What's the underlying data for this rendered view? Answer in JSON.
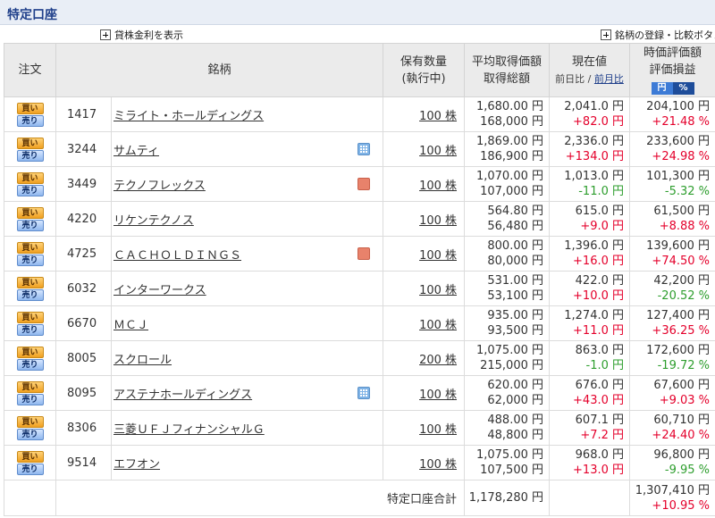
{
  "page_title": "特定口座",
  "toolbar": {
    "lending_label": "貸株金利を表示",
    "register_label": "銘柄の登録・比較ボタン"
  },
  "headers": {
    "order": "注文",
    "name": "銘柄",
    "qty_line1": "保有数量",
    "qty_line2": "(執行中)",
    "avg_line1": "平均取得価額",
    "avg_line2": "取得総額",
    "cur_line1": "現在値",
    "cur_sub_prev_day": "前日比",
    "cur_sub_sep": "/",
    "cur_sub_prev_month": "前月比",
    "val_line1": "時価評価額",
    "val_line2": "評価損益",
    "toggle_yen": "円",
    "toggle_pct": "%"
  },
  "buttons": {
    "buy": "買い",
    "sell": "売り"
  },
  "rows": [
    {
      "code": "1417",
      "name": "ミライト・ホールディングス",
      "badge": "",
      "qty": "100 株",
      "avg_price": "1,680.00 円",
      "avg_total": "168,000 円",
      "current": "2,041.0 円",
      "change": "+82.0 円",
      "change_class": "pos",
      "value": "204,100 円",
      "pl": "+21.48 %",
      "pl_class": "pos"
    },
    {
      "code": "3244",
      "name": "サムティ",
      "badge": "calc",
      "qty": "100 株",
      "avg_price": "1,869.00 円",
      "avg_total": "186,900 円",
      "current": "2,336.0 円",
      "change": "+134.0 円",
      "change_class": "pos",
      "value": "233,600 円",
      "pl": "+24.98 %",
      "pl_class": "pos"
    },
    {
      "code": "3449",
      "name": "テクノフレックス",
      "badge": "info",
      "qty": "100 株",
      "avg_price": "1,070.00 円",
      "avg_total": "107,000 円",
      "current": "1,013.0 円",
      "change": "-11.0 円",
      "change_class": "neg",
      "value": "101,300 円",
      "pl": "-5.32 %",
      "pl_class": "neg"
    },
    {
      "code": "4220",
      "name": "リケンテクノス",
      "badge": "",
      "qty": "100 株",
      "avg_price": "564.80 円",
      "avg_total": "56,480 円",
      "current": "615.0 円",
      "change": "+9.0 円",
      "change_class": "pos",
      "value": "61,500 円",
      "pl": "+8.88 %",
      "pl_class": "pos"
    },
    {
      "code": "4725",
      "name": "ＣＡＣＨＯＬＤＩＮＧＳ",
      "badge": "info",
      "qty": "100 株",
      "avg_price": "800.00 円",
      "avg_total": "80,000 円",
      "current": "1,396.0 円",
      "change": "+16.0 円",
      "change_class": "pos",
      "value": "139,600 円",
      "pl": "+74.50 %",
      "pl_class": "pos"
    },
    {
      "code": "6032",
      "name": "インターワークス",
      "badge": "",
      "qty": "100 株",
      "avg_price": "531.00 円",
      "avg_total": "53,100 円",
      "current": "422.0 円",
      "change": "+10.0 円",
      "change_class": "pos",
      "value": "42,200 円",
      "pl": "-20.52 %",
      "pl_class": "neg"
    },
    {
      "code": "6670",
      "name": "ＭＣＪ",
      "badge": "",
      "qty": "100 株",
      "avg_price": "935.00 円",
      "avg_total": "93,500 円",
      "current": "1,274.0 円",
      "change": "+11.0 円",
      "change_class": "pos",
      "value": "127,400 円",
      "pl": "+36.25 %",
      "pl_class": "pos"
    },
    {
      "code": "8005",
      "name": "スクロール",
      "badge": "",
      "qty": "200 株",
      "avg_price": "1,075.00 円",
      "avg_total": "215,000 円",
      "current": "863.0 円",
      "change": "-1.0 円",
      "change_class": "neg",
      "value": "172,600 円",
      "pl": "-19.72 %",
      "pl_class": "neg"
    },
    {
      "code": "8095",
      "name": "アステナホールディングス",
      "badge": "calc",
      "qty": "100 株",
      "avg_price": "620.00 円",
      "avg_total": "62,000 円",
      "current": "676.0 円",
      "change": "+43.0 円",
      "change_class": "pos",
      "value": "67,600 円",
      "pl": "+9.03 %",
      "pl_class": "pos"
    },
    {
      "code": "8306",
      "name": "三菱ＵＦＪフィナンシャルＧ",
      "badge": "",
      "qty": "100 株",
      "avg_price": "488.00 円",
      "avg_total": "48,800 円",
      "current": "607.1 円",
      "change": "+7.2 円",
      "change_class": "pos",
      "value": "60,710 円",
      "pl": "+24.40 %",
      "pl_class": "pos"
    },
    {
      "code": "9514",
      "name": "エフオン",
      "badge": "",
      "qty": "100 株",
      "avg_price": "1,075.00 円",
      "avg_total": "107,500 円",
      "current": "968.0 円",
      "change": "+13.0 円",
      "change_class": "pos",
      "value": "96,800 円",
      "pl": "-9.95 %",
      "pl_class": "neg"
    }
  ],
  "total": {
    "label": "特定口座合計",
    "cost_total": "1,178,280 円",
    "value_total": "1,307,410 円",
    "pl_total": "+10.95 %",
    "pl_class": "pos"
  },
  "colors": {
    "positive": "#e4002b",
    "negative": "#2e9e2e",
    "title": "#1f3f8a"
  }
}
